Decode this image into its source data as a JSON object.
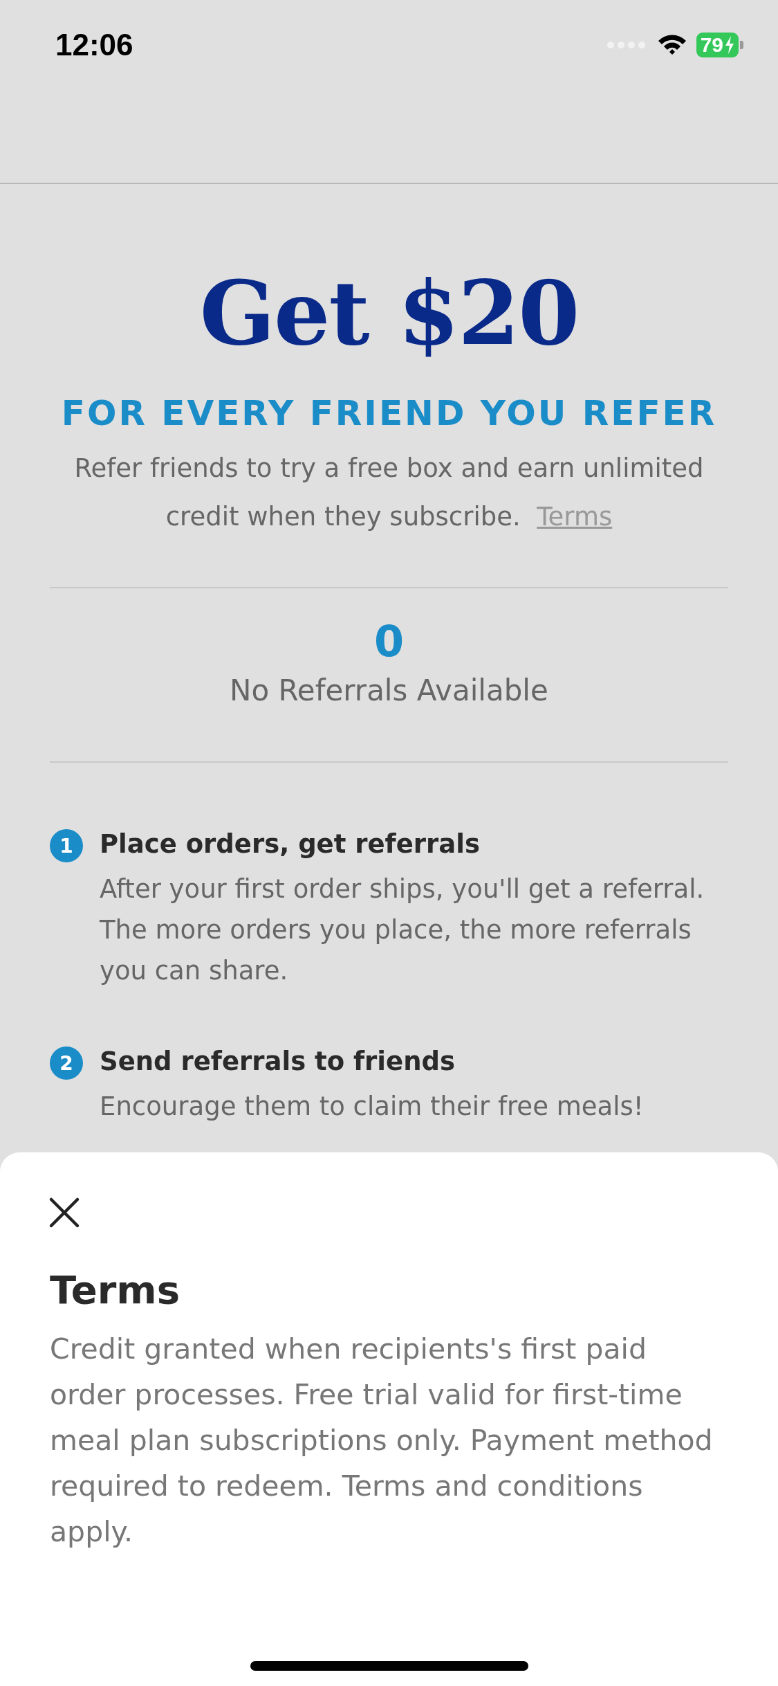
{
  "status_bar": {
    "time": "12:06",
    "battery": "79"
  },
  "hero": {
    "title": "Get $20",
    "subtitle": "FOR EVERY FRIEND YOU REFER",
    "description": "Refer friends to try a free box and earn unlimited credit when they subscribe.",
    "terms_link": "Terms"
  },
  "referrals": {
    "count": "0",
    "label": "No Referrals Available"
  },
  "steps": [
    {
      "number": "1",
      "title": "Place orders, get referrals",
      "body": "After your first order ships, you'll get a referral. The more orders you place, the more referrals you can share."
    },
    {
      "number": "2",
      "title": "Send referrals to friends",
      "body": "Encourage them to claim their free meals!"
    }
  ],
  "sheet": {
    "title": "Terms",
    "body": "Credit granted when recipients's first paid order processes. Free trial valid for first-time meal plan subscriptions only. Payment method required to redeem. Terms and conditions apply."
  }
}
